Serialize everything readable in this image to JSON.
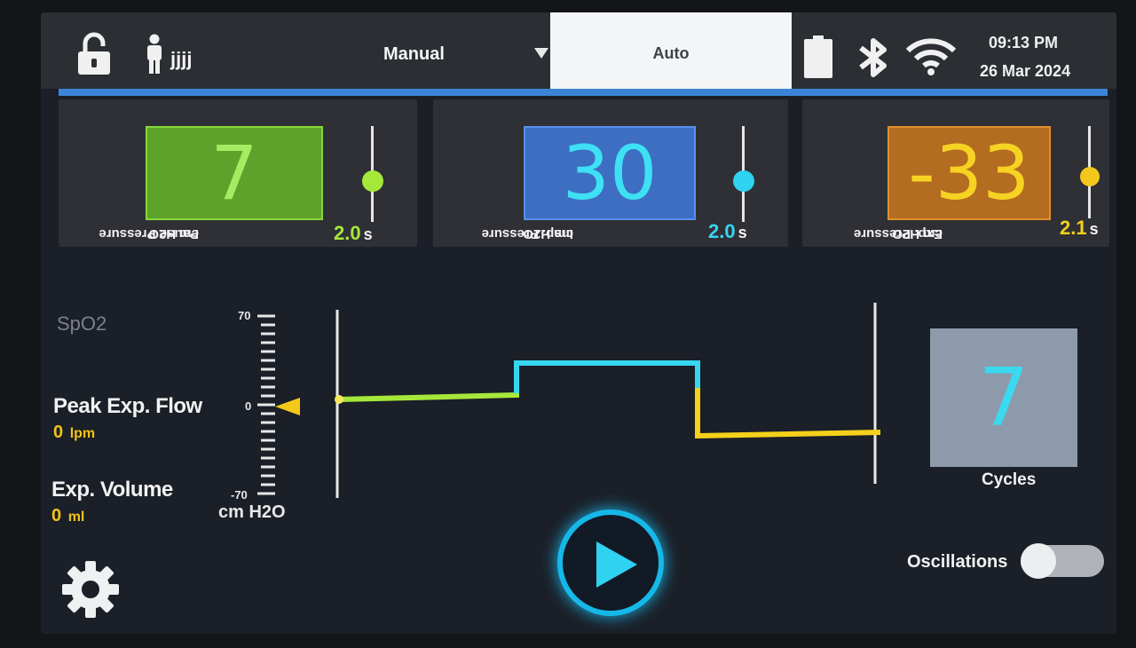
{
  "header": {
    "patient_name": "jjjj",
    "modes": [
      {
        "label": "Manual",
        "selected": false
      },
      {
        "label": "Auto",
        "selected": true
      }
    ],
    "time": "09:13 PM",
    "date": "26 Mar 2024",
    "icons": [
      "lock-icon",
      "person-icon",
      "battery-icon",
      "bluetooth-icon",
      "wifi-icon"
    ]
  },
  "panels": {
    "pause": {
      "label_line1": "Pause Pressure",
      "label_line2": "cm H2O",
      "value": "7",
      "time": "2.0",
      "unit": "s",
      "color": "#55dc28"
    },
    "insp": {
      "label_line1": "Insp. Pressure",
      "label_line2": "cm H2O",
      "value": "30",
      "time": "2.0",
      "unit": "s",
      "color": "#36d6f0"
    },
    "exp": {
      "label_line1": "Exp. Pressure",
      "label_line2": "cm H2O",
      "value": "-33",
      "time": "2.1",
      "unit": "s",
      "color": "#f4d11a"
    }
  },
  "readouts": {
    "spo2_label": "SpO2",
    "peak_flow_label": "Peak Exp. Flow",
    "peak_flow_value": "0",
    "peak_flow_unit": "lpm",
    "exp_volume_label": "Exp. Volume",
    "exp_volume_value": "0",
    "exp_volume_unit": "ml"
  },
  "scale": {
    "max": "70",
    "zero": "0",
    "min": "-70",
    "unit": "cm H2O",
    "colors": {
      "pause": "#a6e83a",
      "insp": "#36d6f0",
      "exp": "#f4d11a"
    }
  },
  "cycles": {
    "value": "7",
    "label": "Cycles"
  },
  "controls": {
    "oscillations_label": "Oscillations",
    "oscillations_on": false
  }
}
